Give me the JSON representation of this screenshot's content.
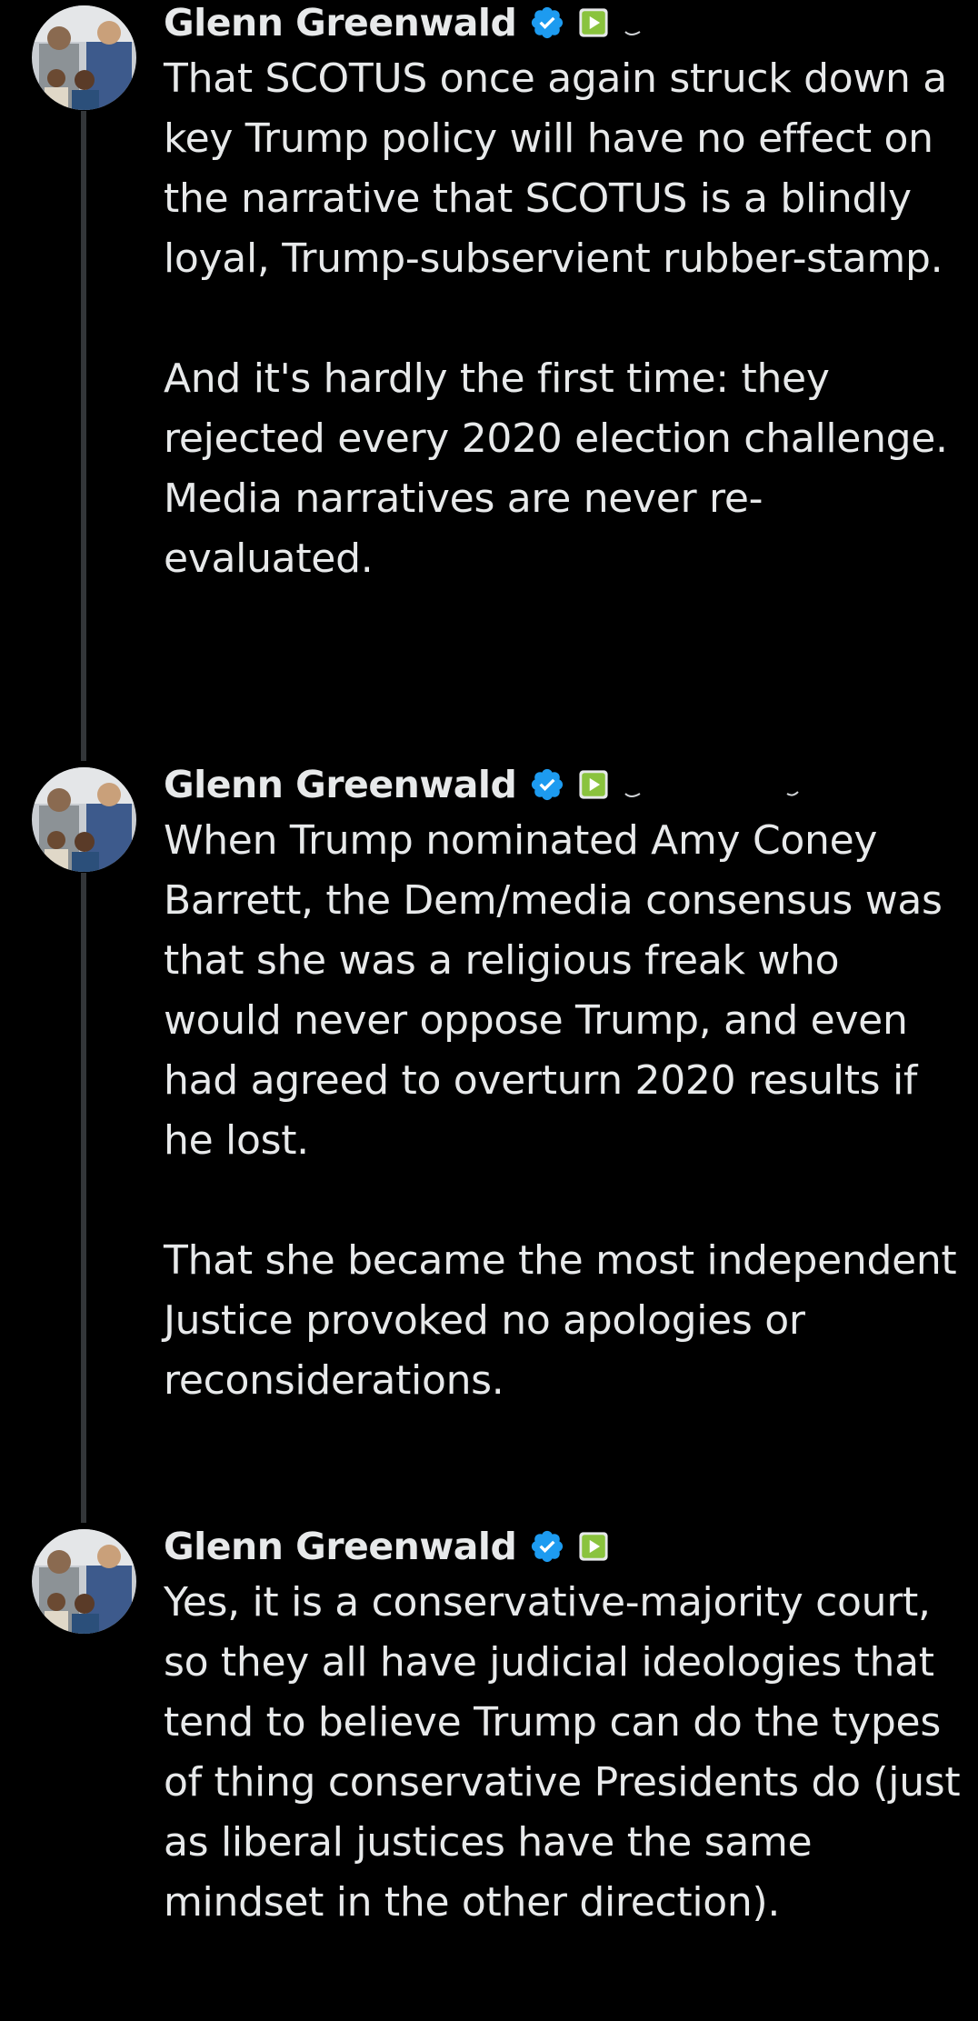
{
  "thread": {
    "colors": {
      "background": "#000000",
      "text": "#e7e9ea",
      "thread_line": "#333639",
      "verified_badge": "#1d9bf0",
      "affiliate_badge": "#8ac33e"
    },
    "tweets": [
      {
        "author": "Glenn Greenwald",
        "badges": [
          "verified-icon",
          "play-icon"
        ],
        "text": "That SCOTUS once again struck down a key Trump policy will have no effect on the narrative that SCOTUS is a blindly loyal, Trump-subservient rubber-stamp.\n\nAnd it's hardly the first time: they rejected every 2020 election challenge. Media narratives are never re-evaluated."
      },
      {
        "author": "Glenn Greenwald",
        "badges": [
          "verified-icon",
          "play-icon"
        ],
        "text": "When Trump nominated Amy Coney Barrett, the Dem/media consensus was that she was a religious freak who would never oppose Trump, and even had agreed to overturn 2020 results if he lost.\n\nThat she became the most independent Justice provoked no apologies or reconsiderations."
      },
      {
        "author": "Glenn Greenwald",
        "badges": [
          "verified-icon",
          "play-icon"
        ],
        "text": "Yes, it is a conservative-majority court, so they all have judicial ideologies that tend to believe Trump can do the types of thing conservative Presidents do (just as liberal justices have the same mindset in the other direction)."
      }
    ]
  }
}
